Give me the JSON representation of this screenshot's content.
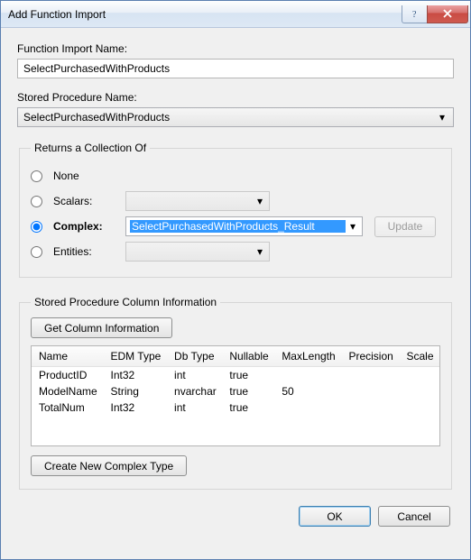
{
  "window": {
    "title": "Add Function Import"
  },
  "labels": {
    "function_import_name": "Function Import Name:",
    "stored_procedure_name": "Stored Procedure Name:",
    "returns_group": "Returns a Collection Of",
    "none": "None",
    "scalars": "Scalars:",
    "complex": "Complex:",
    "entities": "Entities:",
    "update": "Update",
    "spci_group": "Stored Procedure Column Information",
    "get_column_info": "Get Column Information",
    "create_complex": "Create New Complex Type",
    "ok": "OK",
    "cancel": "Cancel"
  },
  "fields": {
    "function_import_name": "SelectPurchasedWithProducts",
    "stored_procedure_name": "SelectPurchasedWithProducts",
    "scalars_value": "",
    "complex_value": "SelectPurchasedWithProducts_Result",
    "entities_value": "",
    "selected_option": "complex"
  },
  "grid": {
    "headers": [
      "Name",
      "EDM Type",
      "Db Type",
      "Nullable",
      "MaxLength",
      "Precision",
      "Scale"
    ],
    "rows": [
      {
        "Name": "ProductID",
        "EDMType": "Int32",
        "DbType": "int",
        "Nullable": "true",
        "MaxLength": "",
        "Precision": "",
        "Scale": ""
      },
      {
        "Name": "ModelName",
        "EDMType": "String",
        "DbType": "nvarchar",
        "Nullable": "true",
        "MaxLength": "50",
        "Precision": "",
        "Scale": ""
      },
      {
        "Name": "TotalNum",
        "EDMType": "Int32",
        "DbType": "int",
        "Nullable": "true",
        "MaxLength": "",
        "Precision": "",
        "Scale": ""
      }
    ]
  }
}
